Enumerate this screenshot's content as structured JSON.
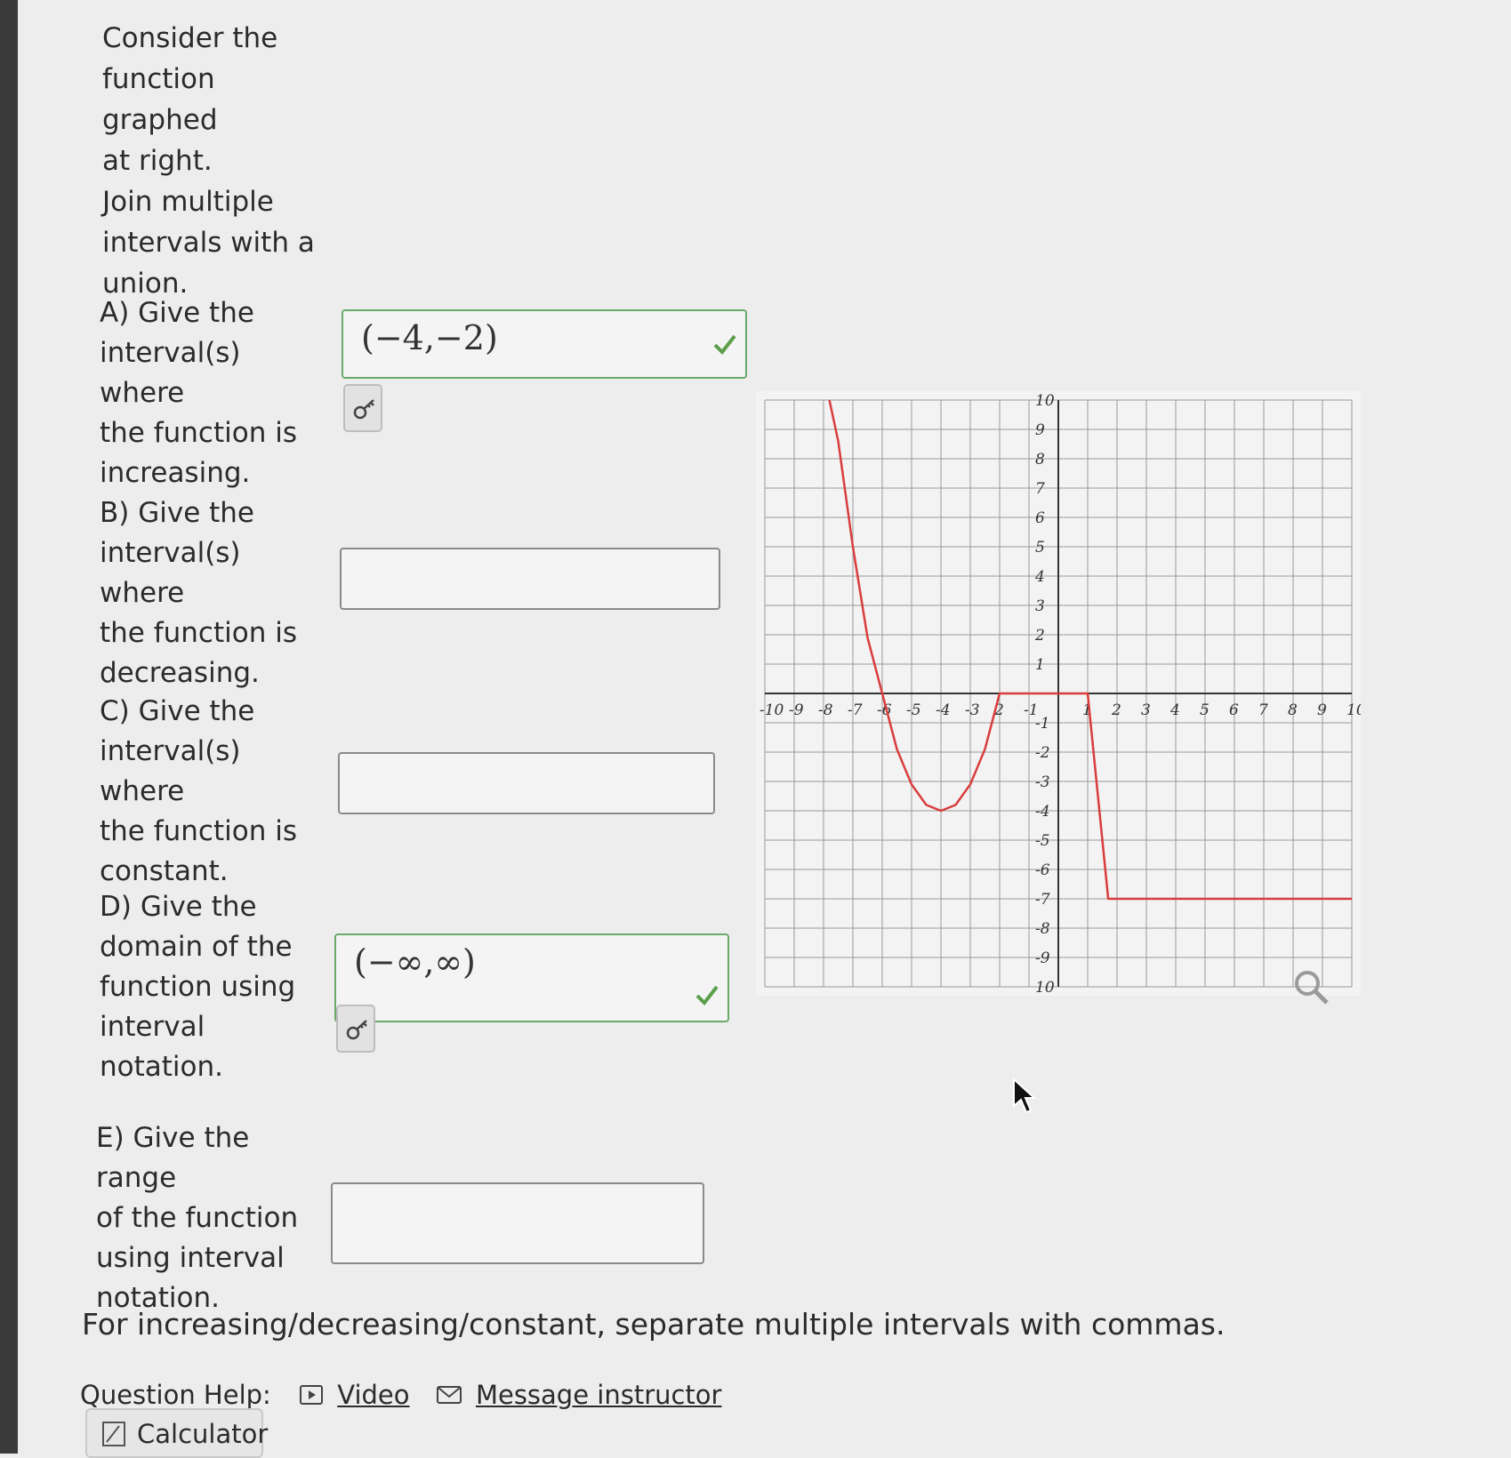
{
  "intro": {
    "line1": "Consider the",
    "line2": "function graphed",
    "line3": "at right.",
    "line4": "Join multiple",
    "line5": "intervals with a",
    "line6": "union."
  },
  "questions": [
    {
      "lines": [
        "A) Give the",
        "interval(s) where",
        "the function is",
        "increasing."
      ],
      "answer": "(−4,−2)",
      "status": "correct"
    },
    {
      "lines": [
        "B) Give the",
        "interval(s) where",
        "the function is",
        "decreasing."
      ],
      "answer": "",
      "status": "empty"
    },
    {
      "lines": [
        "C) Give the",
        "interval(s) where",
        "the function is",
        "constant."
      ],
      "answer": "",
      "status": "empty"
    },
    {
      "lines": [
        "D) Give the",
        "domain of the",
        "function using",
        "interval notation."
      ],
      "answer": "(−∞,∞)",
      "status": "correct"
    },
    {
      "lines": [
        "E) Give the range",
        "of the function",
        "using interval",
        "notation."
      ],
      "answer": "",
      "status": "empty"
    }
  ],
  "footer_note": "For increasing/decreasing/constant, separate multiple intervals with commas.",
  "help": {
    "label": "Question Help:",
    "video": "Video",
    "message": "Message instructor",
    "calculator": "Calculator"
  },
  "colors": {
    "curve": "#d93c3c",
    "correct": "#5a9e4a",
    "grid": "#9a9a9a"
  },
  "icons": {
    "check": "check-icon",
    "key": "key-icon",
    "video": "video-icon",
    "mail": "mail-icon",
    "calculator": "calculator-icon",
    "zoom": "magnifier-icon"
  },
  "chart_data": {
    "type": "line",
    "xlim": [
      -10,
      10
    ],
    "ylim": [
      -10,
      10
    ],
    "grid": true,
    "x_ticks": [
      -10,
      -9,
      -8,
      -7,
      -6,
      -5,
      -4,
      -3,
      -2,
      -1,
      1,
      2,
      3,
      4,
      5,
      6,
      7,
      8,
      9,
      10
    ],
    "y_ticks": [
      10,
      9,
      8,
      7,
      6,
      5,
      4,
      3,
      2,
      1,
      -1,
      -2,
      -3,
      -4,
      -5,
      -6,
      -7,
      -8,
      -9,
      -10
    ],
    "x_tick_labels": [
      "-10",
      "-9",
      "-8",
      "-7",
      "-6",
      "-5",
      "-4",
      "-3",
      "2",
      "-1",
      "1",
      "2",
      "3",
      "4",
      "5",
      "6",
      "7",
      "8",
      "9",
      "10"
    ],
    "y_tick_labels": [
      "10",
      "9",
      "8",
      "7",
      "6",
      "5",
      "4",
      "3",
      "2",
      "1",
      "-1",
      "-2",
      "-3",
      "-4",
      "-5",
      "-6",
      "-7",
      "-8",
      "-9",
      "10"
    ],
    "series": [
      {
        "x": [
          -7.8,
          -7.5,
          -7,
          -6.5,
          -6,
          -5.5,
          -5,
          -4.5,
          -4,
          -3.5,
          -3,
          -2.5,
          -2,
          -1,
          1,
          1.7,
          10
        ],
        "y": [
          10,
          8.6,
          5,
          1.9,
          0,
          -1.9,
          -3.1,
          -3.8,
          -4,
          -3.8,
          -3.1,
          -1.9,
          0,
          0,
          0,
          -7,
          -7
        ]
      }
    ]
  }
}
